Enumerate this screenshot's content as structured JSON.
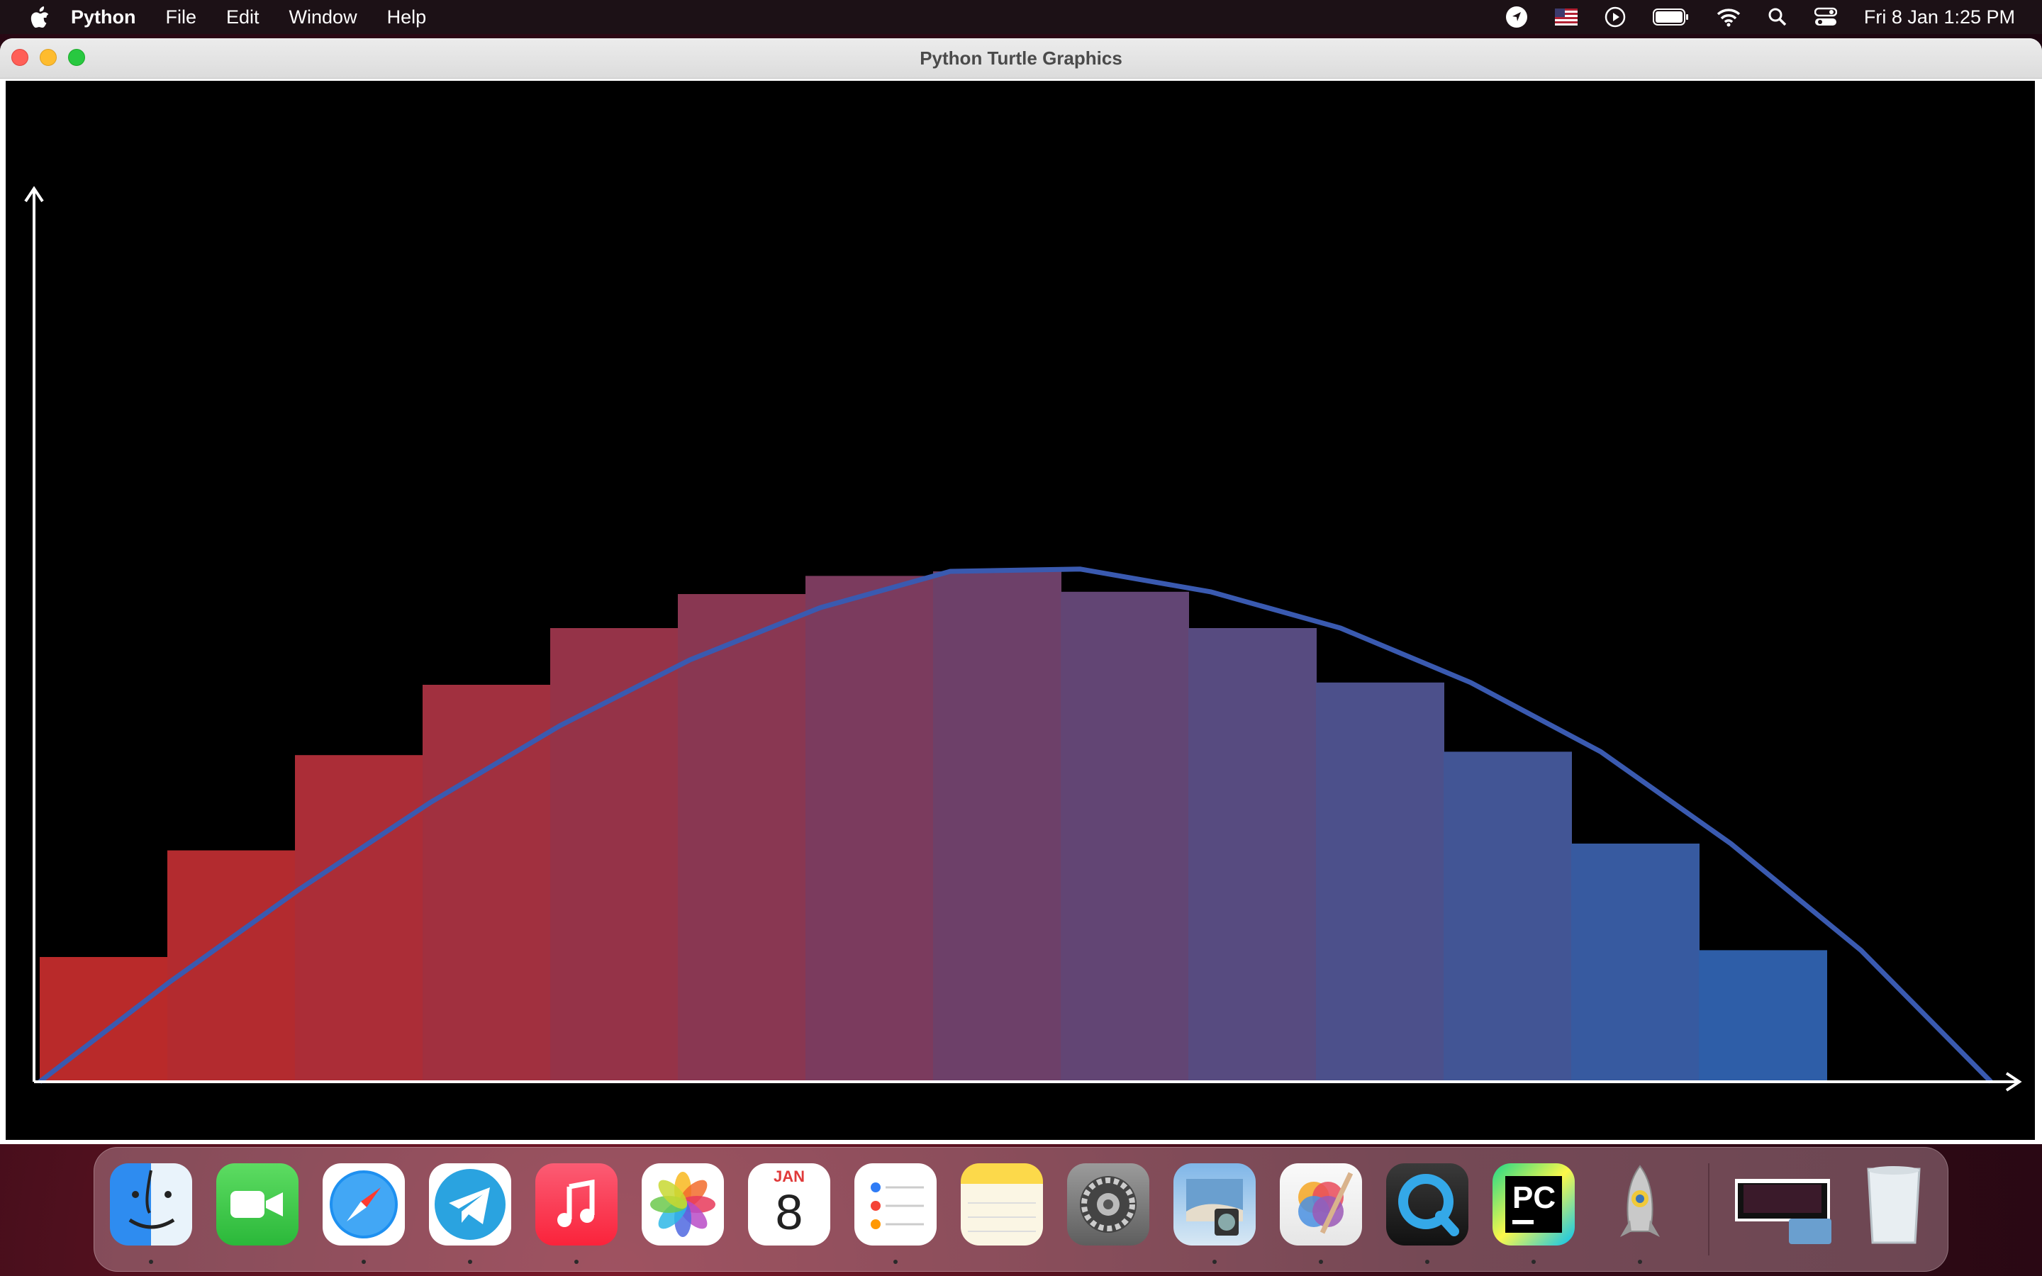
{
  "menubar": {
    "app_name": "Python",
    "menus": [
      "File",
      "Edit",
      "Window",
      "Help"
    ],
    "clock": "Fri 8 Jan  1:25 PM",
    "status_icons": [
      "location-icon",
      "us-flag-icon",
      "play-icon",
      "battery-icon",
      "wifi-icon",
      "search-icon",
      "control-center-icon"
    ]
  },
  "window": {
    "title": "Python Turtle Graphics"
  },
  "chart_data": {
    "type": "bar",
    "description_of_marks": "14 rectangle bars under a curve, with a line curve and x/y axis arrows",
    "bar_heights": [
      110,
      204,
      288,
      350,
      400,
      430,
      446,
      450,
      432,
      400,
      352,
      291,
      210,
      116
    ],
    "curve": [
      [
        0,
        0
      ],
      [
        1,
        88
      ],
      [
        2,
        170
      ],
      [
        3,
        246
      ],
      [
        4,
        314
      ],
      [
        5,
        372
      ],
      [
        6,
        418
      ],
      [
        7,
        450
      ],
      [
        8,
        452
      ],
      [
        9,
        432
      ],
      [
        10,
        400
      ],
      [
        11,
        352
      ],
      [
        12,
        291
      ],
      [
        13,
        210
      ],
      [
        14,
        116
      ],
      [
        15,
        0
      ]
    ],
    "bar_colors": [
      "#b92a2a",
      "#b32b2f",
      "#ab2d37",
      "#a1303f",
      "#953348",
      "#893752",
      "#7b3b5e",
      "#6d4069",
      "#624574",
      "#574b80",
      "#4c508b",
      "#425595",
      "#375aa0",
      "#2e5ea8"
    ],
    "curve_color": "#3a5ab0",
    "axis_color": "#ffffff",
    "grid": false
  },
  "dock": {
    "apps": [
      {
        "name": "finder-icon",
        "running": true
      },
      {
        "name": "facetime-icon",
        "running": false
      },
      {
        "name": "safari-icon",
        "running": true
      },
      {
        "name": "telegram-icon",
        "running": true
      },
      {
        "name": "music-icon",
        "running": true
      },
      {
        "name": "photos-icon",
        "running": false
      },
      {
        "name": "calendar-icon",
        "running": false
      },
      {
        "name": "reminders-icon",
        "running": true
      },
      {
        "name": "notes-icon",
        "running": false
      },
      {
        "name": "system-preferences-icon",
        "running": false
      },
      {
        "name": "preview-icon",
        "running": true
      },
      {
        "name": "pixelmator-icon",
        "running": true
      },
      {
        "name": "quicktime-icon",
        "running": true
      },
      {
        "name": "pycharm-icon",
        "running": true
      },
      {
        "name": "python-launcher-icon",
        "running": true
      }
    ],
    "calendar_month": "JAN",
    "calendar_day": "8",
    "pycharm_label": "PC"
  }
}
